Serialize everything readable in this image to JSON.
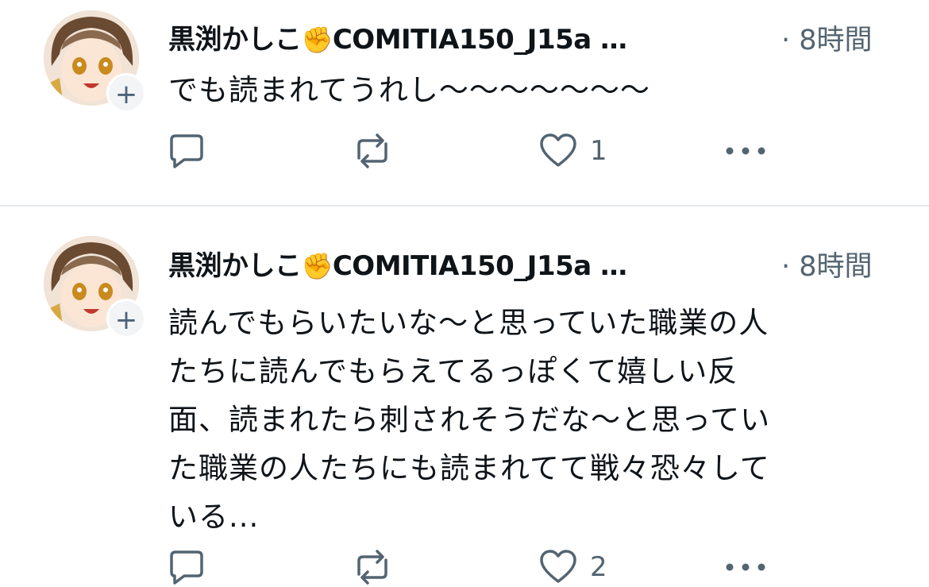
{
  "tweets": [
    {
      "author": "黒渕かしこ",
      "author_suffix": "COMITIA150_J15a …",
      "time": "· 8時間",
      "text": "でも読まれてうれし〜〜〜〜〜〜〜",
      "likes": "1",
      "icons": [
        "reply-icon",
        "retweet-icon",
        "heart-icon",
        "more-icon"
      ]
    },
    {
      "author": "黒渕かしこ",
      "author_suffix": "COMITIA150_J15a …",
      "time": "· 8時間",
      "text": "読んでもらいたいな〜と思っていた職業の人\nたちに読んでもらえてるっぽくて嬉しい反\n面、読まれたら刺されそうだな〜と思ってい\nた職業の人たちにも読まれてて戦々恐々して\nいる...",
      "likes": "2",
      "icons": [
        "reply-icon",
        "retweet-icon",
        "heart-icon",
        "more-icon"
      ]
    }
  ],
  "colors": {
    "text": "#0f1419",
    "secondary": "#536471",
    "divider": "#e6e9ec"
  }
}
